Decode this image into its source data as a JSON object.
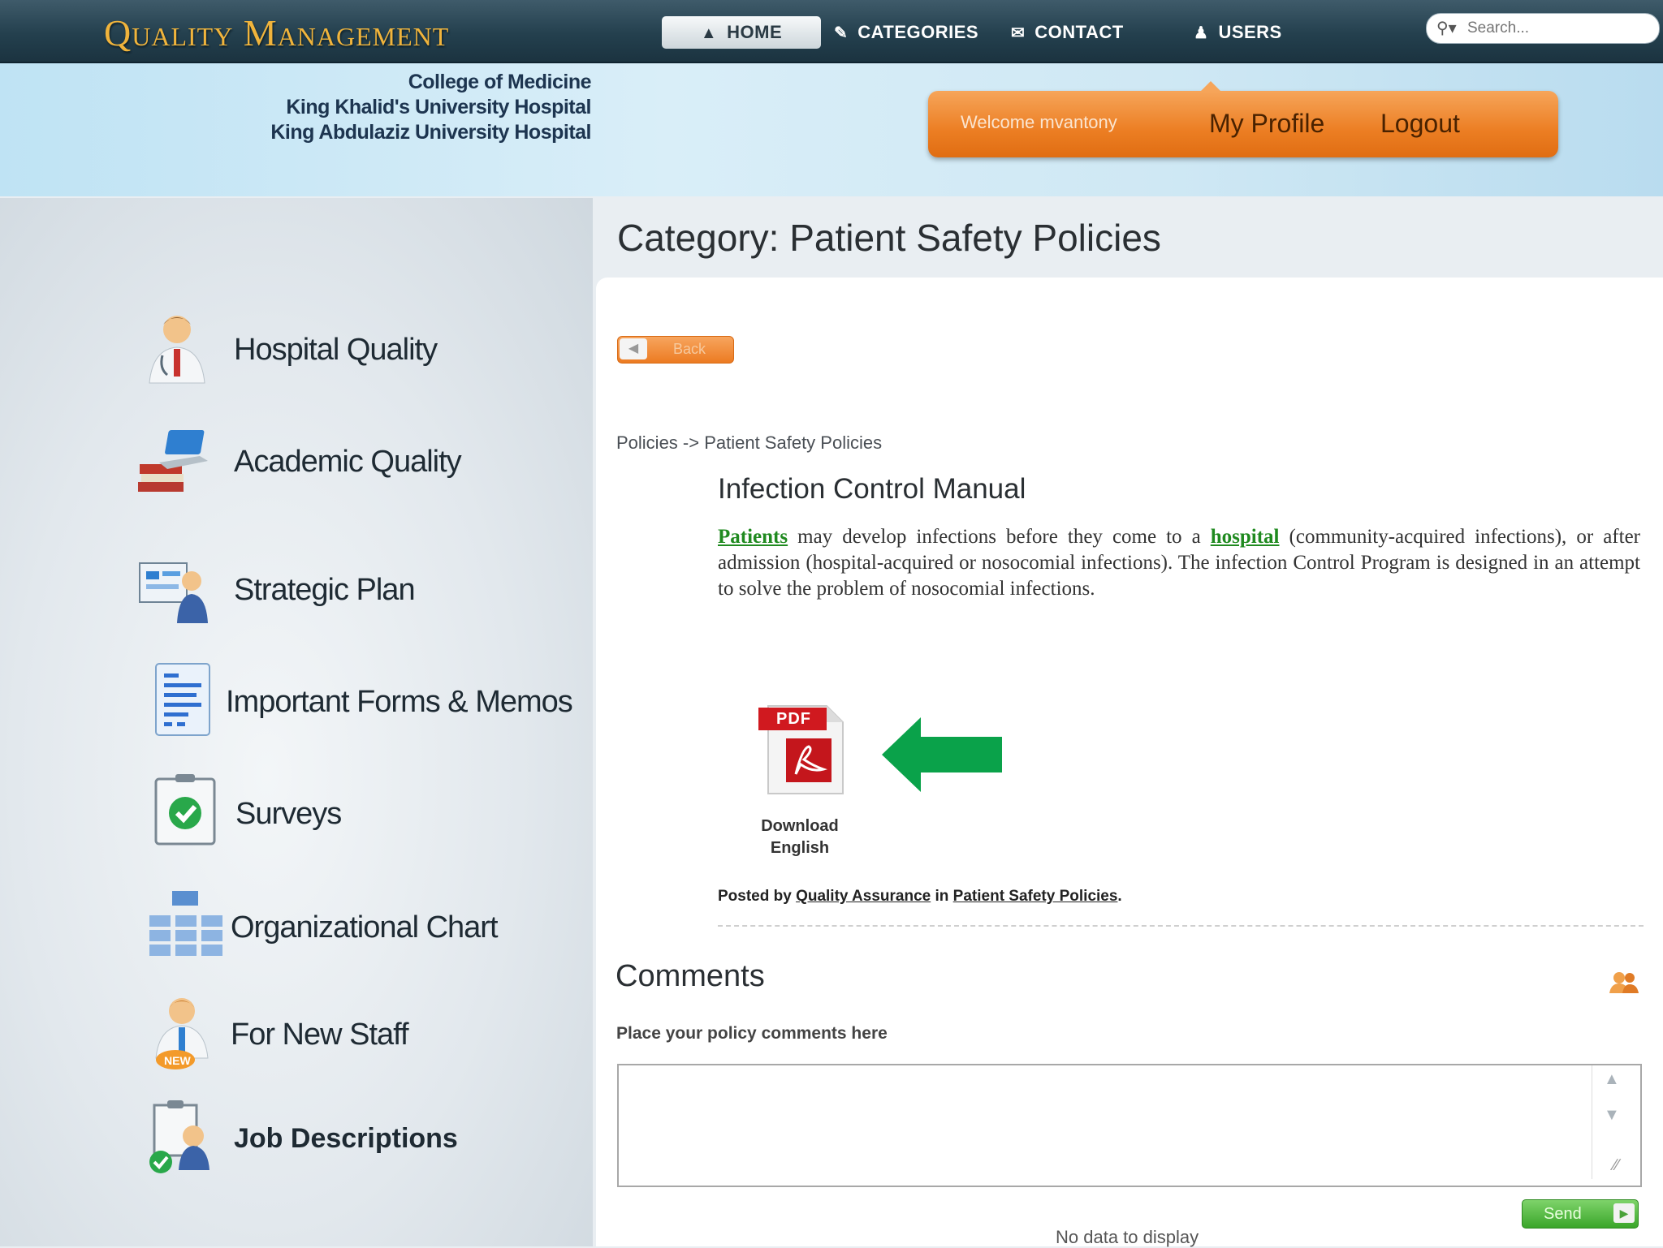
{
  "app": {
    "logo": "Quality Management",
    "nav": [
      {
        "label": "HOME",
        "icon": "home-icon",
        "active": true
      },
      {
        "label": "CATEGORIES",
        "icon": "pencil-icon"
      },
      {
        "label": "CONTACT",
        "icon": "envelope-icon"
      },
      {
        "label": "USERS",
        "icon": "users-icon"
      }
    ],
    "search": {
      "placeholder": "Search..."
    }
  },
  "header": {
    "college": [
      "College of Medicine",
      "King Khalid's University Hospital",
      "King Abdulaziz University Hospital"
    ],
    "welcome": "Welcome mvantony",
    "my_profile": "My Profile",
    "logout": "Logout"
  },
  "sidebar": {
    "items": [
      {
        "label": "Hospital Quality",
        "icon": "doctor-icon"
      },
      {
        "label": "Academic Quality",
        "icon": "books-laptop-icon"
      },
      {
        "label": "Strategic Plan",
        "icon": "presentation-icon"
      },
      {
        "label": "Important Forms & Memos",
        "icon": "document-icon"
      },
      {
        "label": "Surveys",
        "icon": "survey-check-icon"
      },
      {
        "label": "Organizational Chart",
        "icon": "org-chart-icon"
      },
      {
        "label": "For New Staff",
        "icon": "new-staff-icon"
      },
      {
        "label": "Job Descriptions",
        "icon": "job-description-icon"
      }
    ]
  },
  "main": {
    "title": "Category: Patient Safety Policies",
    "back_label": "Back",
    "breadcrumb": "Policies -> Patient Safety Policies",
    "doc_title": "Infection Control Manual",
    "body": {
      "link1": "Patients",
      "text1": " may develop infections before they come to a ",
      "link2": "hospital",
      "text2": " (community-acquired infections), or after admission (hospital-acquired or nosocomial infections). The infection Control Program is designed in an attempt to solve the problem of nosocomial infections."
    },
    "download": {
      "pdf_tag": "PDF",
      "line1": "Download",
      "line2": "English"
    },
    "posted": {
      "prefix": "Posted by ",
      "author": "Quality Assurance",
      "mid": " in ",
      "category": "Patient Safety Policies",
      "suffix": "."
    },
    "comments": {
      "heading": "Comments",
      "prompt": "Place your policy comments here",
      "send_label": "Send",
      "empty": "No data to display"
    }
  },
  "colors": {
    "accent_orange": "#ec7e23",
    "link_green": "#1f8a1f",
    "arrow_green": "#0aa24a",
    "top_bar": "#24404e",
    "logo_gold": "#f0b43c"
  }
}
